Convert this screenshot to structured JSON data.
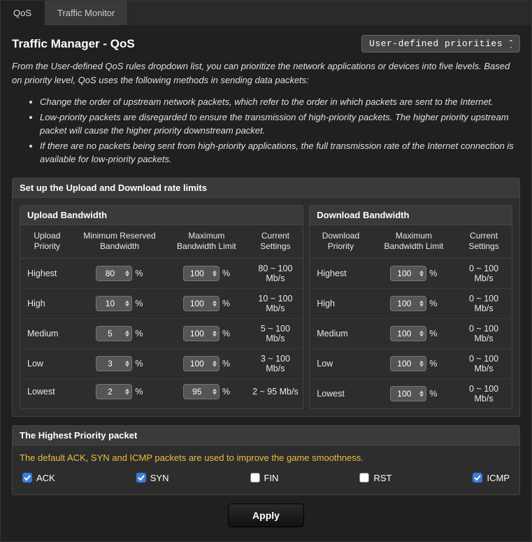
{
  "tabs": [
    {
      "label": "QoS",
      "active": true
    },
    {
      "label": "Traffic Monitor",
      "active": false
    }
  ],
  "page_title": "Traffic Manager - QoS",
  "dropdown_selected": "User-defined priorities",
  "intro": "From the User-defined QoS rules dropdown list, you can prioritize the network applications or devices into five levels. Based on priority level, QoS uses the following methods in sending data packets:",
  "bullets": [
    "Change the order of upstream network packets, which refer to the order in which packets are sent to the Internet.",
    "Low-priority packets are disregarded to ensure the transmission of high-priority packets. The higher priority upstream packet will cause the higher priority downstream packet.",
    "If there are no packets being sent from high-priority applications, the full transmission rate of the Internet connection is available for low-priority packets."
  ],
  "rate_panel_title": "Set up the Upload and Download rate limits",
  "upload": {
    "title": "Upload Bandwidth",
    "headers": [
      "Upload Priority",
      "Minimum Reserved Bandwidth",
      "Maximum Bandwidth Limit",
      "Current Settings"
    ],
    "rows": [
      {
        "priority": "Highest",
        "min": "80",
        "max": "100",
        "current": "80 ~ 100 Mb/s"
      },
      {
        "priority": "High",
        "min": "10",
        "max": "100",
        "current": "10 ~ 100 Mb/s"
      },
      {
        "priority": "Medium",
        "min": "5",
        "max": "100",
        "current": "5 ~ 100 Mb/s"
      },
      {
        "priority": "Low",
        "min": "3",
        "max": "100",
        "current": "3 ~ 100 Mb/s"
      },
      {
        "priority": "Lowest",
        "min": "2",
        "max": "95",
        "current": "2 ~ 95 Mb/s"
      }
    ]
  },
  "download": {
    "title": "Download Bandwidth",
    "headers": [
      "Download Priority",
      "Maximum Bandwidth Limit",
      "Current Settings"
    ],
    "rows": [
      {
        "priority": "Highest",
        "max": "100",
        "current": "0 ~ 100 Mb/s"
      },
      {
        "priority": "High",
        "max": "100",
        "current": "0 ~ 100 Mb/s"
      },
      {
        "priority": "Medium",
        "max": "100",
        "current": "0 ~ 100 Mb/s"
      },
      {
        "priority": "Low",
        "max": "100",
        "current": "0 ~ 100 Mb/s"
      },
      {
        "priority": "Lowest",
        "max": "100",
        "current": "0 ~ 100 Mb/s"
      }
    ]
  },
  "hp_panel_title": "The Highest Priority packet",
  "hp_text": "The default ACK, SYN and ICMP packets are used to improve the game smoothness.",
  "checks": [
    {
      "label": "ACK",
      "checked": true
    },
    {
      "label": "SYN",
      "checked": true
    },
    {
      "label": "FIN",
      "checked": false
    },
    {
      "label": "RST",
      "checked": false
    },
    {
      "label": "ICMP",
      "checked": true
    }
  ],
  "apply_label": "Apply",
  "pct": "%"
}
